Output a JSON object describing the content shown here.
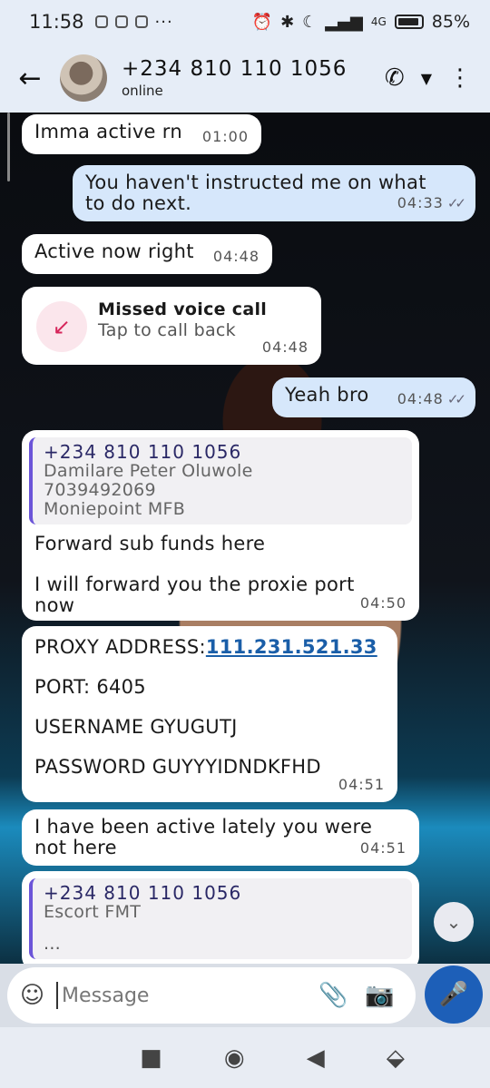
{
  "status_bar": {
    "time": "11:58",
    "more": "···",
    "network": "4G",
    "battery": "85%"
  },
  "header": {
    "back_icon": "arrow-left",
    "contact_name": "+234 810 110 1056",
    "contact_status": "online",
    "call_icon": "phone",
    "dropdown_icon": "caret-down",
    "menu_icon": "vertical-dots"
  },
  "messages": [
    {
      "direction": "in",
      "text": "Imma active rn",
      "time": "01:00"
    },
    {
      "direction": "out",
      "text": "You haven't instructed me on what to do next.",
      "time": "04:33"
    },
    {
      "direction": "in",
      "text": "Active now right",
      "time": "04:48"
    },
    {
      "direction": "in",
      "type": "missed_call",
      "title": "Missed voice call",
      "subtitle": "Tap to call back",
      "time": "04:48"
    },
    {
      "direction": "out",
      "text": "Yeah bro",
      "time": "04:48"
    },
    {
      "direction": "in",
      "quote": {
        "name": "+234 810 110 1056",
        "lines": [
          "Damilare Peter Oluwole",
          "7039492069",
          "Moniepoint MFB"
        ]
      },
      "text_1": "Forward sub funds here",
      "text_2": "I will forward you the proxie port now",
      "time": "04:50"
    },
    {
      "direction": "in",
      "proxy_label": "PROXY ADDRESS:",
      "proxy_value": "111.231.521.33",
      "port": "PORT: 6405",
      "username": "USERNAME GYUGUTJ",
      "password": "PASSWORD GUYYYIDNDKFHD",
      "time": "04:51"
    },
    {
      "direction": "in",
      "text": "I have been active lately you were not here",
      "time": "04:51"
    },
    {
      "direction": "in",
      "quote": {
        "name": "+234 810 110 1056",
        "lines": [
          "Escort FMT"
        ]
      },
      "text": "..."
    }
  ],
  "input": {
    "placeholder": "Message"
  },
  "colors": {
    "accent": "#1d5fb8",
    "outgoing_bubble": "#d6e7fb",
    "quote_bar": "#6b54d8",
    "missed_call": "#d6255a"
  }
}
